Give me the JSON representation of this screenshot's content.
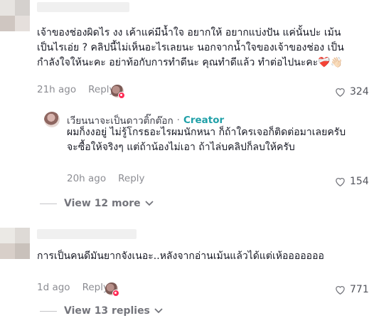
{
  "comments": [
    {
      "text": "เจ้าของช่องผิดไร งง เค้าแค่มีน้ำใจ อยากให้ อยากแบ่งปัน แค่นั้นปะ เม้นเป็นไรเอ่ย ? คลิปนี้ไม่เห็นอะไรเลยนะ นอกจากน้ำใจของเจ้าของช่อง เป็นกำลังใจให้นะคะ อย่าท้อกับการทำดีนะ คุณทำดีแล้ว ทำต่อไปนะคะ❤️‍🩹👋🏻",
      "time": "21h ago",
      "reply_label": "Reply",
      "likes": "324",
      "reply": {
        "author": "เวียนนาจะเป็นดาวติ๊กต๊อก",
        "separator": "·",
        "creator_label": "Creator",
        "text": "ผมก็งงอยู่ ไม่รู้โกรธอะไรผมนักหนา ก็ถ้าใครเจอก็ติดต่อมาเลยครับ จะซื้อให้จริงๆ แต่ถ้าน้องไม่เอา ถ้าไล่บคลิปก็ลบให้ครับ",
        "time": "20h ago",
        "reply_label": "Reply",
        "likes": "154"
      },
      "view_more": "View 12 more"
    },
    {
      "text": "การเป็นคนดีมันยากจังเนอะ..หลังจากอ่านเม้นแล้วได้แต่เห้อออออออ",
      "time": "1d ago",
      "reply_label": "Reply",
      "likes": "771",
      "view_more": "View 13 replies"
    }
  ],
  "icons": {
    "like": "heart-outline-icon",
    "chevron": "chevron-down-icon"
  },
  "colors": {
    "creator": "#20a0a8",
    "badge": "#fe2c55",
    "muted_text": "#8a8b91"
  }
}
